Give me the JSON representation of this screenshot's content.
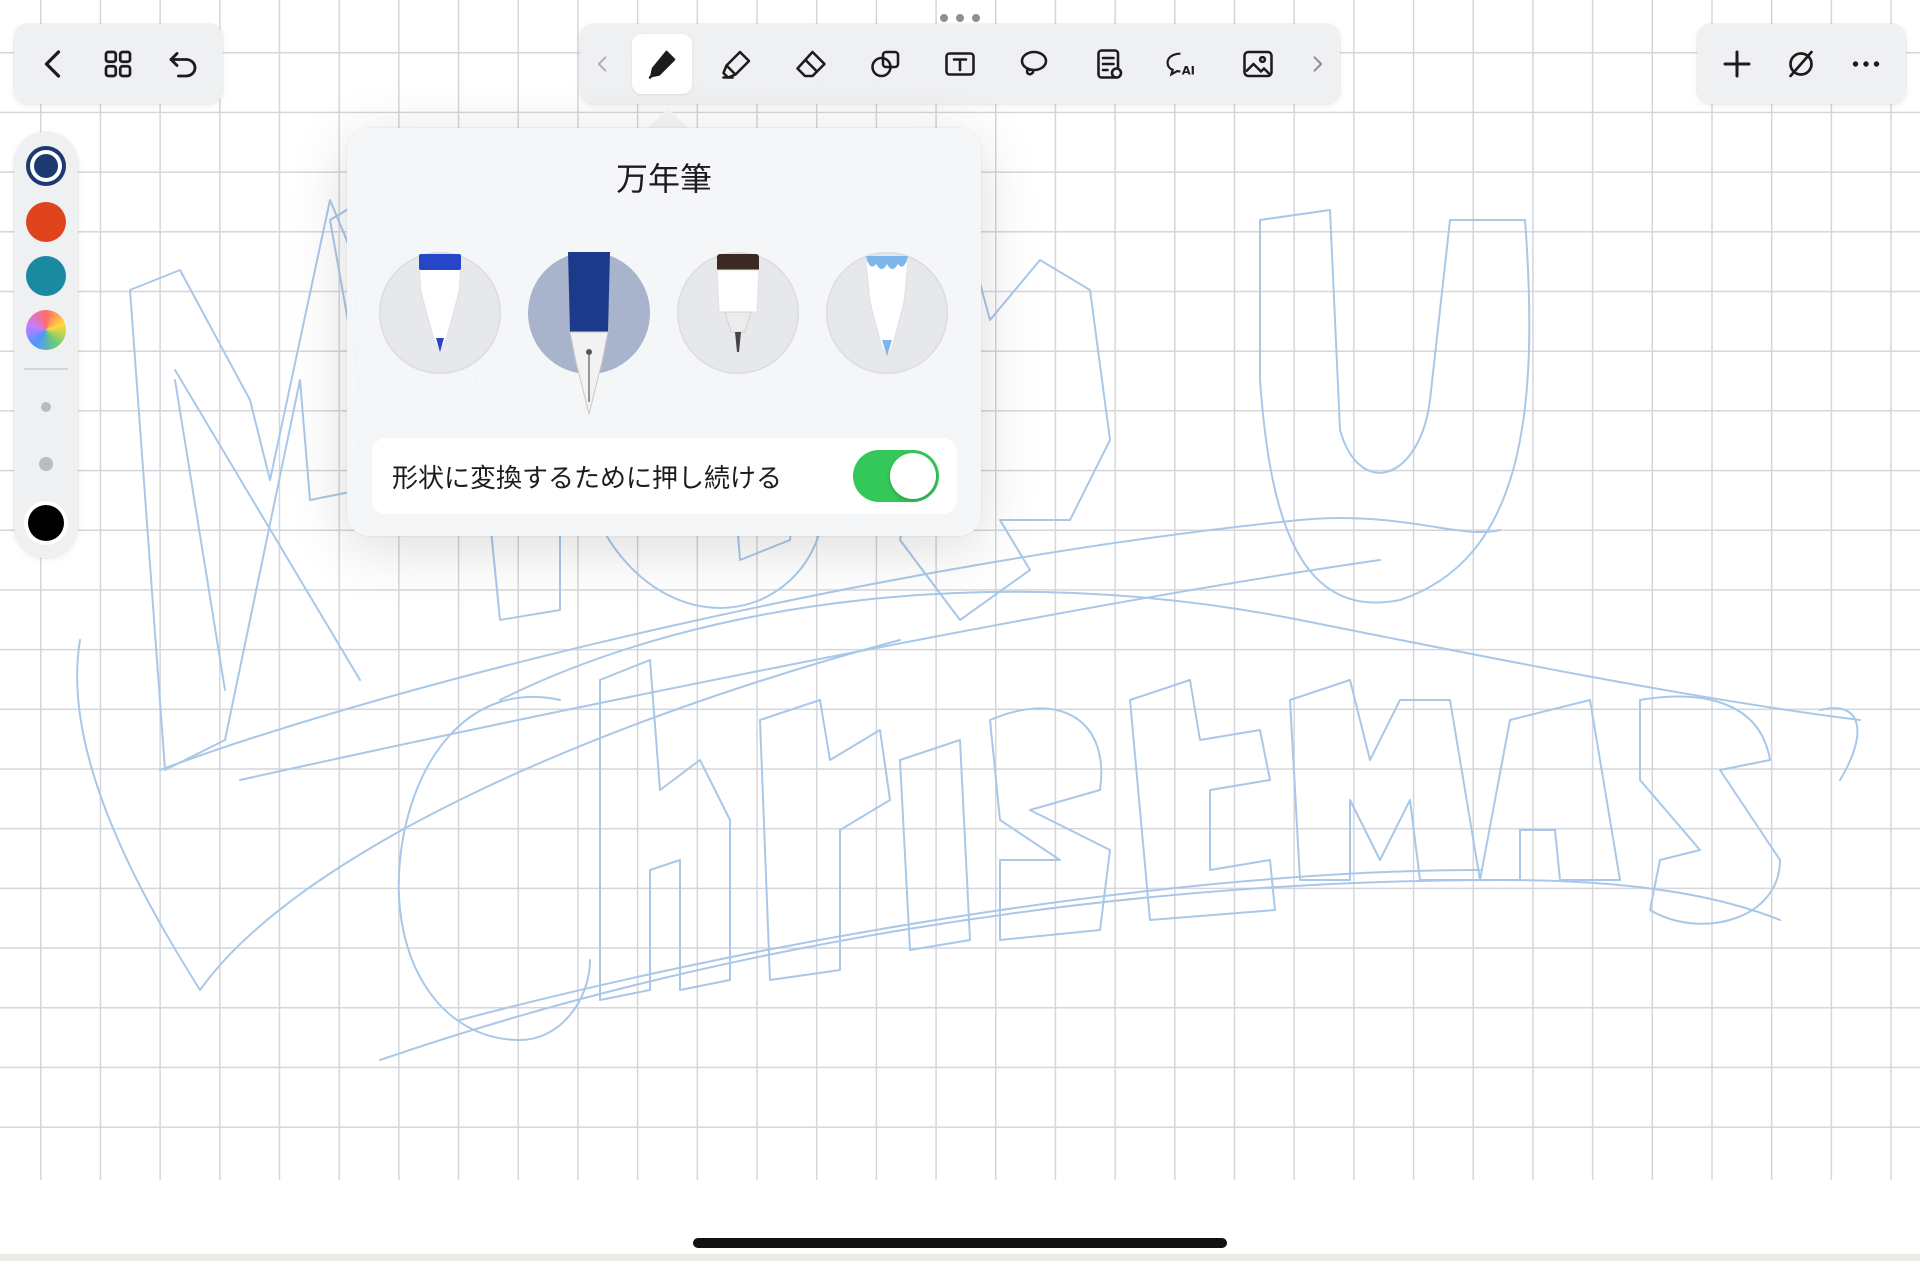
{
  "app": {
    "toolbar_left": {
      "back_icon": "chevron-left-icon",
      "grid_icon": "grid-icon",
      "undo_icon": "undo-icon"
    },
    "toolbar_center": {
      "tools": [
        {
          "name": "fountain-pen",
          "icon": "pen-icon",
          "active": true
        },
        {
          "name": "highlighter",
          "icon": "highlighter-icon"
        },
        {
          "name": "eraser",
          "icon": "eraser-icon"
        },
        {
          "name": "shapes",
          "icon": "shapes-icon"
        },
        {
          "name": "text",
          "icon": "textbox-icon"
        },
        {
          "name": "lasso",
          "icon": "lasso-icon"
        },
        {
          "name": "sticky-notes",
          "icon": "notes-icon"
        },
        {
          "name": "ai-chat",
          "icon": "ai-chat-icon",
          "badge": "AI"
        },
        {
          "name": "image",
          "icon": "image-icon"
        }
      ]
    },
    "toolbar_right": {
      "add_icon": "plus-icon",
      "no_pencil_icon": "pencil-slash-icon",
      "more_icon": "ellipsis-icon"
    },
    "palette": {
      "colors": [
        "#1c3a70",
        "#e0441c",
        "#1a8aa0",
        "rainbow"
      ],
      "selected_color": "#1c3a70",
      "black": "#000000"
    },
    "pen_popover": {
      "title": "万年筆",
      "pens": [
        "ballpoint",
        "fountain",
        "fineliner",
        "brush"
      ],
      "selected_pen": "fountain",
      "toggle_label": "形状に変換するために押し続ける",
      "toggle_on": true
    },
    "ink_color": "#a9c8e8"
  }
}
